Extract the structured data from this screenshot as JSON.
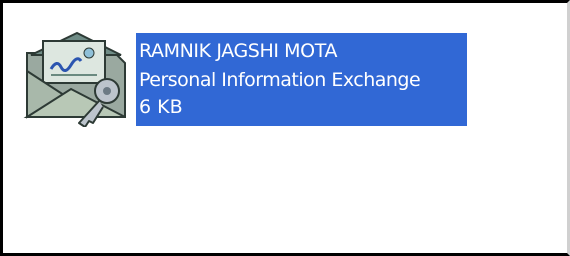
{
  "file": {
    "name": "RAMNIK JAGSHI MOTA",
    "type": "Personal Information Exchange",
    "size": "6 KB",
    "icon": "certificate-envelope-key-icon",
    "selected": true
  },
  "colors": {
    "selection_bg": "#3168d5",
    "selection_text": "#ffffff",
    "pane_bg": "#ffffff"
  }
}
